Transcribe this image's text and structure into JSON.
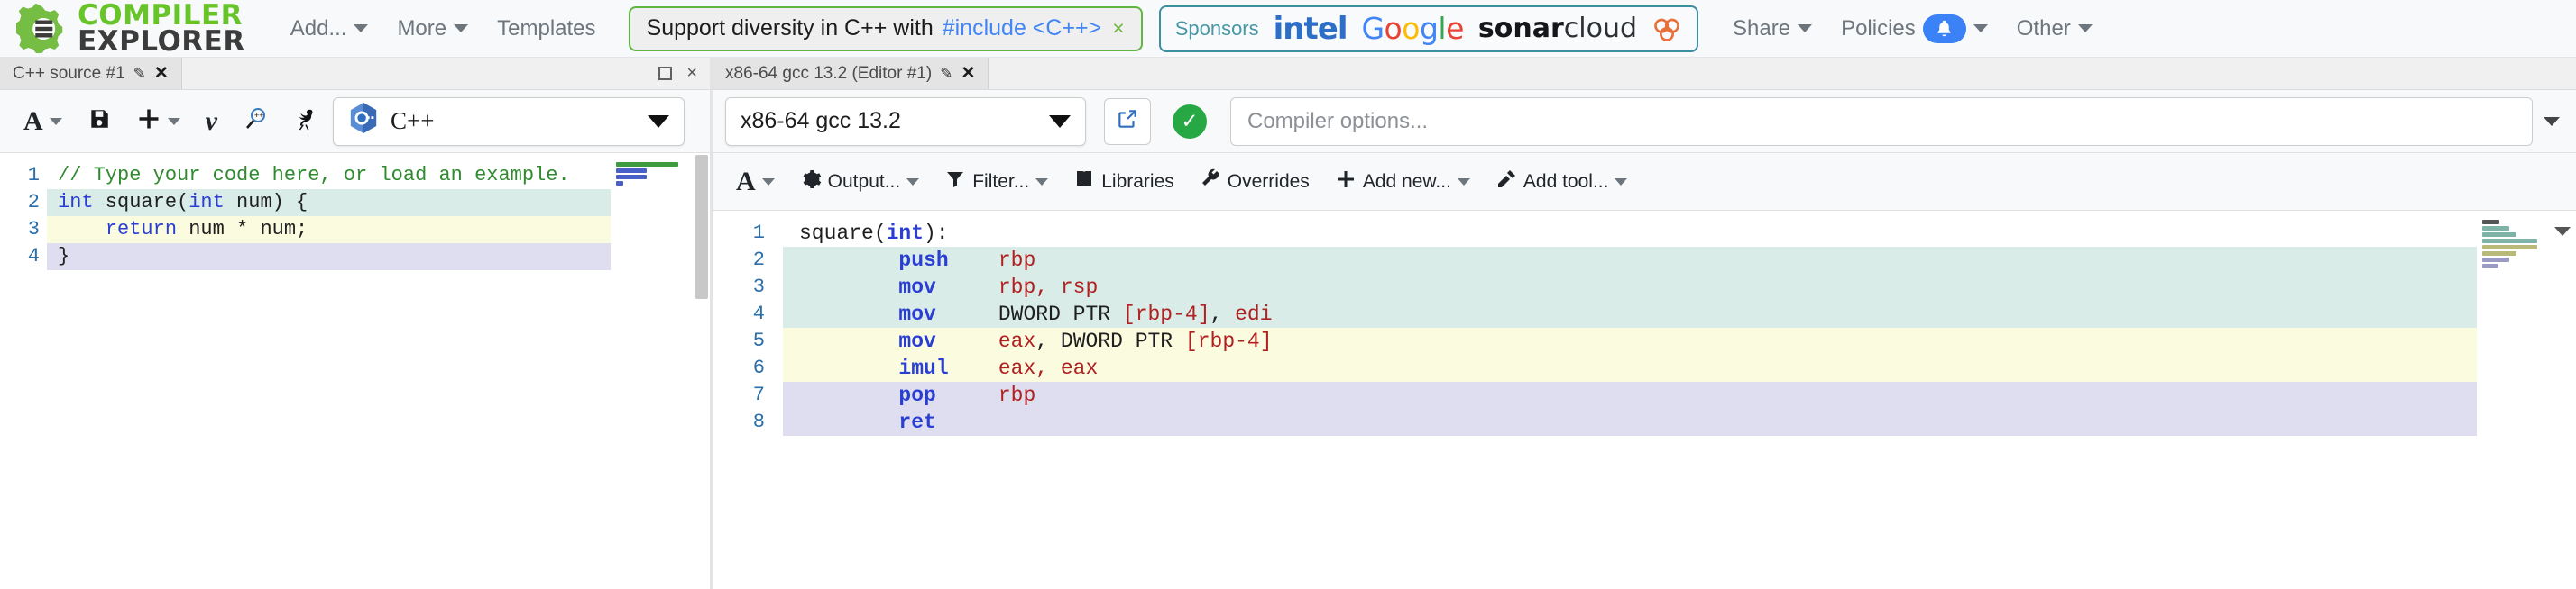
{
  "navbar": {
    "brand": {
      "line1": "COMPILER",
      "line2": "EXPLORER",
      "icon": "gear-logo"
    },
    "menu": [
      {
        "label": "Add...",
        "caret": true
      },
      {
        "label": "More",
        "caret": true
      },
      {
        "label": "Templates",
        "caret": false
      }
    ],
    "diversity": {
      "text": "Support diversity in C++ with",
      "link": "#include <C++>",
      "close": "×",
      "border_color": "#62b543",
      "link_color": "#4285f4"
    },
    "sponsors": {
      "label": "Sponsors",
      "items": [
        "intel",
        "Google",
        "sonarcloud"
      ],
      "google_letters": [
        "G",
        "o",
        "o",
        "g",
        "l",
        "e"
      ],
      "sonar_bold": "sonar",
      "sonar_light": "cloud",
      "border_color": "#3c8f9e"
    },
    "right_menu": [
      {
        "label": "Share",
        "caret": true,
        "badge": false
      },
      {
        "label": "Policies",
        "caret": true,
        "badge": true,
        "badge_icon": "bell-icon",
        "badge_color": "#3b82f6"
      },
      {
        "label": "Other",
        "caret": true,
        "badge": false
      }
    ]
  },
  "editor_pane": {
    "tab": {
      "title": "C++ source #1",
      "edit_icon": "pencil-icon",
      "close_icon": "close-icon"
    },
    "window_controls": {
      "maximize": "maximize-icon",
      "close": "×"
    },
    "toolbar": [
      {
        "name": "font-size-button",
        "glyph": "A",
        "caret": true
      },
      {
        "name": "save-button",
        "glyph": "save-icon",
        "caret": false
      },
      {
        "name": "add-button",
        "glyph": "plus-icon",
        "caret": true
      },
      {
        "name": "vim-mode-button",
        "glyph": "v",
        "caret": false
      },
      {
        "name": "preprocessor-button",
        "glyph": "magnifier-c-icon",
        "caret": false
      },
      {
        "name": "emu-button",
        "glyph": "ostrich-icon",
        "caret": false
      }
    ],
    "language": {
      "value": "C++",
      "icon": "cpp-logo-icon"
    },
    "code": {
      "lines": [
        {
          "n": 1,
          "hl": "",
          "tokens": [
            {
              "t": "// Type your code here, or load an example.",
              "c": "c-comment"
            }
          ]
        },
        {
          "n": 2,
          "hl": "hl-teal",
          "tokens": [
            {
              "t": "int",
              "c": "c-type"
            },
            {
              "t": " square(",
              "c": "c-fn"
            },
            {
              "t": "int",
              "c": "c-type"
            },
            {
              "t": " num) {",
              "c": "c-fn"
            }
          ]
        },
        {
          "n": 3,
          "hl": "hl-yellow",
          "tokens": [
            {
              "t": "    ",
              "c": ""
            },
            {
              "t": "return",
              "c": "c-key"
            },
            {
              "t": " num * num;",
              "c": "c-fn"
            }
          ]
        },
        {
          "n": 4,
          "hl": "hl-purple",
          "tokens": [
            {
              "t": "}",
              "c": "c-fn"
            }
          ]
        }
      ]
    }
  },
  "output_pane": {
    "tab": {
      "title": "x86-64 gcc 13.2 (Editor #1)",
      "edit_icon": "pencil-icon",
      "close_icon": "close-icon"
    },
    "compiler": {
      "value": "x86-64 gcc 13.2"
    },
    "popout_icon": "external-link-icon",
    "status": {
      "icon": "check-icon",
      "color": "#28a745"
    },
    "options_placeholder": "Compiler options...",
    "toolbar": [
      {
        "name": "font-size-button",
        "label": "",
        "glyph": "A",
        "caret": true
      },
      {
        "name": "output-button",
        "label": "Output...",
        "glyph": "gear-icon",
        "caret": true
      },
      {
        "name": "filter-button",
        "label": "Filter...",
        "glyph": "funnel-icon",
        "caret": true
      },
      {
        "name": "libraries-button",
        "label": "Libraries",
        "glyph": "book-icon",
        "caret": false
      },
      {
        "name": "overrides-button",
        "label": "Overrides",
        "glyph": "wrench-icon",
        "caret": false
      },
      {
        "name": "add-new-button",
        "label": "Add new...",
        "glyph": "plus-icon",
        "caret": true
      },
      {
        "name": "add-tool-button",
        "label": "Add tool...",
        "glyph": "tool-icon",
        "caret": true
      }
    ],
    "asm": {
      "lines": [
        {
          "n": 1,
          "hl": "",
          "tokens": [
            {
              "t": "square(",
              "c": "a-label"
            },
            {
              "t": "int",
              "c": "a-op"
            },
            {
              "t": "):",
              "c": "a-label"
            }
          ]
        },
        {
          "n": 2,
          "hl": "hl-teal",
          "tokens": [
            {
              "t": "        ",
              "c": ""
            },
            {
              "t": "push",
              "c": "a-op"
            },
            {
              "t": "    rbp",
              "c": "a-reg"
            }
          ]
        },
        {
          "n": 3,
          "hl": "hl-teal",
          "tokens": [
            {
              "t": "        ",
              "c": ""
            },
            {
              "t": "mov",
              "c": "a-op"
            },
            {
              "t": "     rbp, rsp",
              "c": "a-reg"
            }
          ]
        },
        {
          "n": 4,
          "hl": "hl-teal",
          "tokens": [
            {
              "t": "        ",
              "c": ""
            },
            {
              "t": "mov",
              "c": "a-op"
            },
            {
              "t": "     DWORD PTR ",
              "c": "a-kw"
            },
            {
              "t": "[rbp-4]",
              "c": "a-reg"
            },
            {
              "t": ", ",
              "c": "a-kw"
            },
            {
              "t": "edi",
              "c": "a-reg"
            }
          ]
        },
        {
          "n": 5,
          "hl": "hl-yellow",
          "tokens": [
            {
              "t": "        ",
              "c": ""
            },
            {
              "t": "mov",
              "c": "a-op"
            },
            {
              "t": "     ",
              "c": ""
            },
            {
              "t": "eax",
              "c": "a-reg"
            },
            {
              "t": ", DWORD PTR ",
              "c": "a-kw"
            },
            {
              "t": "[rbp-4]",
              "c": "a-reg"
            }
          ]
        },
        {
          "n": 6,
          "hl": "hl-yellow",
          "tokens": [
            {
              "t": "        ",
              "c": ""
            },
            {
              "t": "imul",
              "c": "a-op"
            },
            {
              "t": "    ",
              "c": ""
            },
            {
              "t": "eax, eax",
              "c": "a-reg"
            }
          ]
        },
        {
          "n": 7,
          "hl": "hl-purple",
          "tokens": [
            {
              "t": "        ",
              "c": ""
            },
            {
              "t": "pop",
              "c": "a-op"
            },
            {
              "t": "     rbp",
              "c": "a-reg"
            }
          ]
        },
        {
          "n": 8,
          "hl": "hl-purple",
          "tokens": [
            {
              "t": "        ",
              "c": ""
            },
            {
              "t": "ret",
              "c": "a-op"
            }
          ]
        }
      ]
    }
  }
}
